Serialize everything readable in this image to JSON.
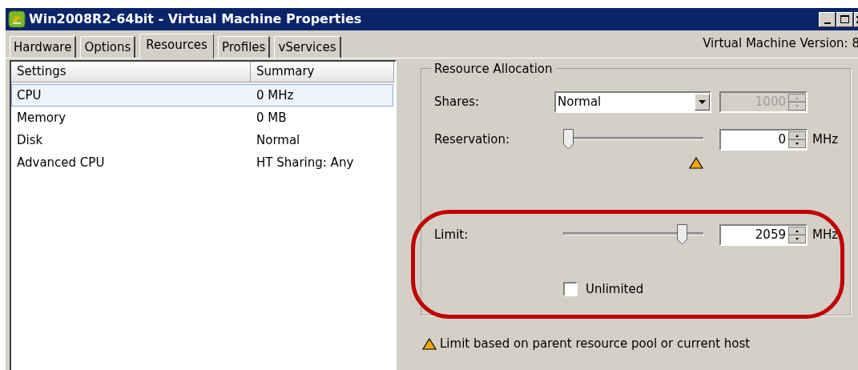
{
  "window": {
    "title": "Win2008R2-64bit - Virtual Machine Properties"
  },
  "tabs": [
    {
      "label": "Hardware",
      "selected": false
    },
    {
      "label": "Options",
      "selected": false
    },
    {
      "label": "Resources",
      "selected": true
    },
    {
      "label": "Profiles",
      "selected": false
    },
    {
      "label": "vServices",
      "selected": false
    }
  ],
  "version_label": "Virtual Machine Version: 8",
  "settings_table": {
    "columns": [
      "Settings",
      "Summary"
    ],
    "rows": [
      {
        "setting": "CPU",
        "summary": "0 MHz",
        "selected": true
      },
      {
        "setting": "Memory",
        "summary": "0 MB",
        "selected": false
      },
      {
        "setting": "Disk",
        "summary": "Normal",
        "selected": false
      },
      {
        "setting": "Advanced CPU",
        "summary": "HT Sharing: Any",
        "selected": false
      }
    ]
  },
  "resource_allocation": {
    "title": "Resource Allocation",
    "shares": {
      "label": "Shares:",
      "value": "Normal",
      "count": "1000",
      "disabled": true
    },
    "reservation": {
      "label": "Reservation:",
      "level": 0,
      "value": "0",
      "unit": "MHz"
    },
    "limit": {
      "label": "Limit:",
      "level": 0.87,
      "value": "2059",
      "unit": "MHz",
      "unlimited": {
        "label": "Unlimited",
        "checked": false
      }
    }
  },
  "footnote": "Limit based on parent resource pool or current host"
}
